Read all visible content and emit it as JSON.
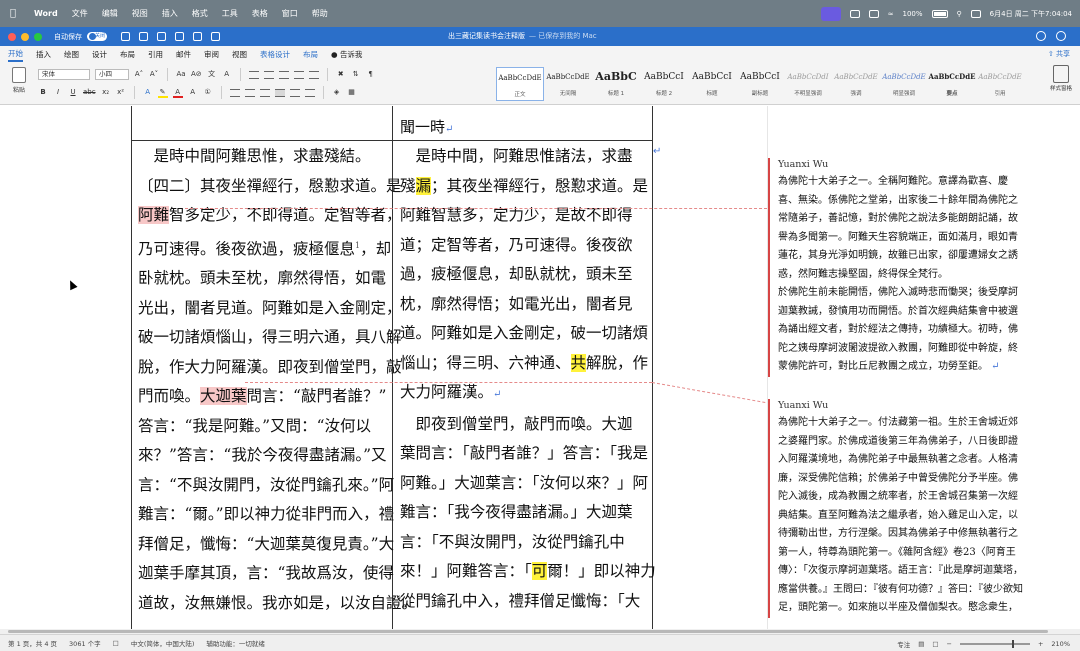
{
  "menubar": {
    "app": "Word",
    "items": [
      "文件",
      "编辑",
      "视图",
      "插入",
      "格式",
      "工具",
      "表格",
      "窗口",
      "帮助"
    ],
    "battery": "100%",
    "datetime": "6月4日 周二 下午7:04:04"
  },
  "titlebar": {
    "autosave_label": "自动保存",
    "autosave_state": "关闭",
    "doc_name": "出三藏记集读书会注释版",
    "saved_status": "— 已保存到我的 Mac"
  },
  "tabs": [
    "开始",
    "插入",
    "绘图",
    "设计",
    "布局",
    "引用",
    "邮件",
    "审阅",
    "视图",
    "表格设计",
    "布局",
    "告诉我"
  ],
  "share_label": "共享",
  "ribbon": {
    "paste_label": "粘贴",
    "font_name": "宋体",
    "font_size": "小四",
    "styles": [
      {
        "preview": "AaBbCcDdE",
        "name": "正文"
      },
      {
        "preview": "AaBbCcDdE",
        "name": "无间隔"
      },
      {
        "preview": "AaBbC",
        "name": "标题 1"
      },
      {
        "preview": "AaBbCcI",
        "name": "标题 2"
      },
      {
        "preview": "AaBbCcI",
        "name": "标题"
      },
      {
        "preview": "AaBbCcI",
        "name": "副标题"
      },
      {
        "preview": "AaBbCcDdI",
        "name": "不明显强调"
      },
      {
        "preview": "AaBbCcDdE",
        "name": "强调"
      },
      {
        "preview": "AaBbCcDdE",
        "name": "明显强调"
      },
      {
        "preview": "AaBbCcDdE",
        "name": "要点"
      },
      {
        "preview": "AaBbCcDdE",
        "name": "引用"
      }
    ],
    "styles_pane_label": "样式窗格"
  },
  "document": {
    "header_right": "聞一時",
    "left_lines": [
      "　是時中間阿難思惟，求盡殘結。",
      "〔四二〕其夜坐禪經行，慇懃求道。是",
      "阿難智多定少，不即得道。定智等者，",
      "乃可速得。後夜欲過，疲極偃息",
      "卧就枕。頭未至枕，廓然得悟，如電",
      "光出，闇者見道。阿難如是入金剛定，",
      "破一切諸煩惱山，得三明六通，具八解",
      "脫，作大力阿羅漢。即夜到僧堂門，敲",
      "門而喚。大迦葉問言：“敲門者誰？”",
      "答言：“我是阿難。”又問：“汝何以",
      "來？”答言：“我於今夜得盡諸漏。”又",
      "言：“不與汝開門，汝從門鑰孔來。”阿",
      "難言：“爾。”即以神力從非門而入，禮",
      "拜僧足，懺悔：“大迦葉莫復見責。”大",
      "迦葉手摩其頂，言：“我故爲汝，使得",
      "道故，汝無嫌恨。我亦如是，以汝自證。"
    ],
    "left_marks": {
      "anan": "阿難",
      "dajiaye": "大迦葉",
      "footnote": "1",
      "after_footnote": "，却"
    },
    "right_lines": [
      "　是時中間，阿難思惟諸法，求盡",
      "殘漏；其夜坐禪經行，慇懃求道。是",
      "阿難智慧多，定力少，是故不即得",
      "道；定智等者，乃可速得。後夜欲",
      "過，疲極偃息，却臥就枕，頭未至",
      "枕，廓然得悟；如電光出，闇者見",
      "道。阿難如是入金剛定，破一切諸煩",
      "惱山；得三明、六神通、共解脫，作",
      "大力阿羅漢。",
      "　即夜到僧堂門，敲門而喚。大迦",
      "葉問言：「敲門者誰？」答言：「我是",
      "阿難。」大迦葉言：「汝何以來？」阿",
      "難言：「我今夜得盡諸漏。」大迦葉",
      "言：「不與汝開門，汝從門鑰孔中",
      "來！」阿難答言：「可爾！」即以神力",
      "從門鑰孔中入，禮拜僧足懺悔：「大"
    ],
    "right_marks": {
      "lou": "漏",
      "gong": "共",
      "ke": "可"
    }
  },
  "comments": [
    {
      "author": "Yuanxi Wu",
      "lines": [
        "為佛陀十大弟子之一。全稱阿難陀。意譯為歡喜、慶",
        "喜、無染。係佛陀之堂弟，出家後二十餘年間為佛陀之",
        "常隨弟子，善記憶，對於佛陀之說法多能朗朗記誦，故",
        "譽為多聞第一。阿難天生容貌端正，面如滿月，眼如青",
        "蓮花，其身光淨如明鏡，故雖已出家，卻屢遭婦女之誘",
        "惑，然阿難志操堅固，終得保全梵行。",
        "於佛陀生前未能開悟，佛陀入滅時悲而慟哭；後受摩訶",
        "迦葉教誡，發憤用功而開悟。於首次經典結集會中被選",
        "為誦出經文者，對於經法之傳持，功績極大。初時，佛",
        "陀之姨母摩訶波闍波提欲入教團，阿難即從中幹旋，終",
        "蒙佛陀許可，對比丘尼教團之成立，功勞至鉅。"
      ]
    },
    {
      "author": "Yuanxi Wu",
      "lines": [
        "為佛陀十大弟子之一。付法藏第一祖。生於王舍城近郊",
        "之婆羅門家。於佛成道後第三年為佛弟子，八日後即證",
        "入阿羅漢境地，為佛陀弟子中最無執著之念者。人格清",
        "廉，深受佛陀信賴；於佛弟子中曾受佛陀分予半座。佛",
        "陀入滅後，成為教團之統率者，於王舍城召集第一次經",
        "典結集。直至阿難為法之繼承者，始入雞足山入定，以",
        "待彌勒出世，方行涅槃。因其為佛弟子中修無執著行之",
        "第一人，特尊為頭陀第一。《雜阿含經》卷23〈阿育王",
        "傳〉：「次復示摩訶迦葉塔。語王言：『此是摩訶迦葉塔，",
        "應當供養。』王問曰：『彼有何功德？』答曰：『彼少欲知",
        "足，頭陀第一。如來施以半座及僧伽梨衣。愍念衆生，"
      ]
    }
  ],
  "statusbar": {
    "page": "第 1 页，共 4 页",
    "words": "3061 个字",
    "language": "中文(简体，中国大陆)",
    "accessibility": "辅助功能：一切就绪",
    "focus": "专注",
    "zoom": "210%"
  }
}
